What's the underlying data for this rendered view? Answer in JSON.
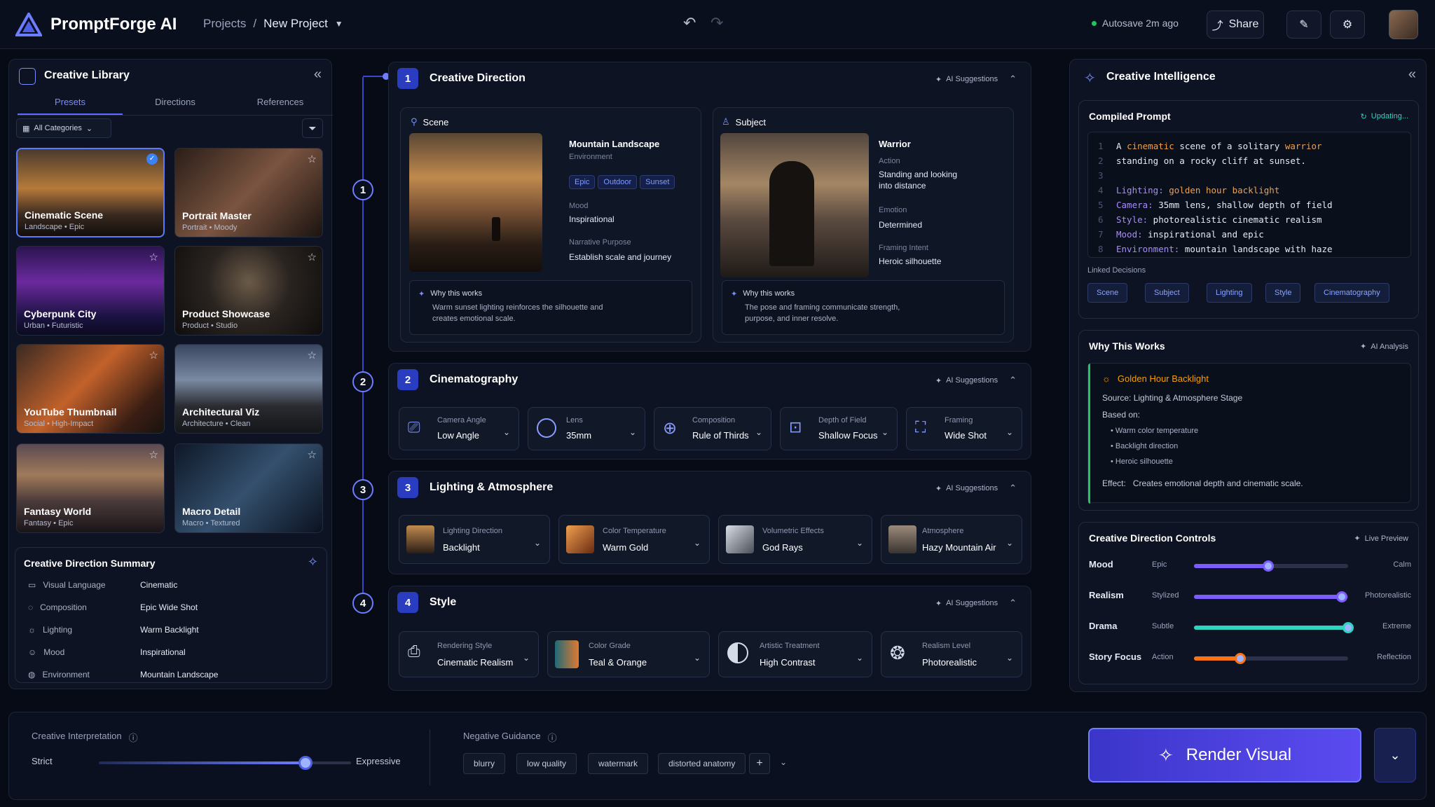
{
  "topbar": {
    "app_name": "PromptForge AI",
    "breadcrumb_root": "Projects",
    "breadcrumb_sep": "/",
    "breadcrumb_current": "New Project",
    "autosave": "Autosave 2m ago",
    "share_label": "Share"
  },
  "library": {
    "title": "Creative Library",
    "tabs": [
      "Presets",
      "Directions",
      "References"
    ],
    "filter": "All Categories",
    "presets": [
      {
        "title": "Cinematic Scene",
        "sub": "Landscape • Epic"
      },
      {
        "title": "Portrait Master",
        "sub": "Portrait • Moody"
      },
      {
        "title": "Cyberpunk City",
        "sub": "Urban • Futuristic"
      },
      {
        "title": "Product Showcase",
        "sub": "Product • Studio"
      },
      {
        "title": "YouTube Thumbnail",
        "sub": "Social • High-Impact"
      },
      {
        "title": "Architectural Viz",
        "sub": "Architecture • Clean"
      },
      {
        "title": "Fantasy World",
        "sub": "Fantasy • Epic"
      },
      {
        "title": "Macro Detail",
        "sub": "Macro • Textured"
      }
    ],
    "summary_title": "Creative Direction Summary",
    "summary": [
      {
        "label": "Visual Language",
        "value": "Cinematic"
      },
      {
        "label": "Composition",
        "value": "Epic Wide Shot"
      },
      {
        "label": "Lighting",
        "value": "Warm Backlight"
      },
      {
        "label": "Mood",
        "value": "Inspirational"
      },
      {
        "label": "Environment",
        "value": "Mountain Landscape"
      }
    ]
  },
  "steps": [
    "1",
    "2",
    "3",
    "4"
  ],
  "ai_suggestions": "AI Suggestions",
  "direction": {
    "num": "1",
    "title": "Creative Direction",
    "scene": {
      "header": "Scene",
      "name": "Mountain Landscape",
      "type": "Environment",
      "tags": [
        "Epic",
        "Outdoor",
        "Sunset"
      ],
      "mood_label": "Mood",
      "mood": "Inspirational",
      "purpose_label": "Narrative Purpose",
      "purpose": "Establish scale and journey",
      "why_title": "Why this works",
      "why_text_1": "Warm sunset lighting reinforces the silhouette and",
      "why_text_2": "creates emotional scale."
    },
    "subject": {
      "header": "Subject",
      "name": "Warrior",
      "action_label": "Action",
      "action_1": "Standing and looking",
      "action_2": "into distance",
      "emotion_label": "Emotion",
      "emotion": "Determined",
      "framing_label": "Framing Intent",
      "framing": "Heroic silhouette",
      "why_title": "Why this works",
      "why_text_1": "The pose and framing communicate strength,",
      "why_text_2": "purpose, and inner resolve."
    }
  },
  "cinematography": {
    "num": "2",
    "title": "Cinematography",
    "controls": [
      {
        "label": "Camera Angle",
        "value": "Low Angle"
      },
      {
        "label": "Lens",
        "value": "35mm"
      },
      {
        "label": "Composition",
        "value": "Rule of Thirds"
      },
      {
        "label": "Depth of Field",
        "value": "Shallow Focus"
      },
      {
        "label": "Framing",
        "value": "Wide Shot"
      }
    ]
  },
  "lighting": {
    "num": "3",
    "title": "Lighting & Atmosphere",
    "controls": [
      {
        "label": "Lighting Direction",
        "value": "Backlight"
      },
      {
        "label": "Color Temperature",
        "value": "Warm Gold"
      },
      {
        "label": "Volumetric Effects",
        "value": "God Rays"
      },
      {
        "label": "Atmosphere",
        "value": "Hazy Mountain Air"
      }
    ]
  },
  "style": {
    "num": "4",
    "title": "Style",
    "controls": [
      {
        "label": "Rendering Style",
        "value": "Cinematic Realism"
      },
      {
        "label": "Color Grade",
        "value": "Teal & Orange"
      },
      {
        "label": "Artistic Treatment",
        "value": "High Contrast"
      },
      {
        "label": "Realism Level",
        "value": "Photorealistic"
      }
    ]
  },
  "intelligence": {
    "title": "Creative Intelligence",
    "compiled_title": "Compiled Prompt",
    "updating": "Updating...",
    "line_numbers": [
      "1",
      "2",
      "3",
      "4",
      "5",
      "6",
      "7",
      "8"
    ],
    "code": {
      "l1_a": "A ",
      "l1_b": "cinematic",
      "l1_c": " scene of a solitary ",
      "l1_d": "warrior",
      "l2": "standing on a rocky cliff at sunset.",
      "l4_k": "Lighting:",
      "l4_v": " golden hour backlight",
      "l5_k": "Camera:",
      "l5_v": " 35mm lens, shallow depth of field",
      "l6_k": "Style:",
      "l6_v": " photorealistic cinematic realism",
      "l7_k": "Mood:",
      "l7_v": " inspirational and epic",
      "l8_k": "Environment:",
      "l8_v": " mountain landscape with haze"
    },
    "linked_title": "Linked Decisions",
    "linked": [
      "Scene",
      "Subject",
      "Lighting",
      "Style",
      "Cinematography"
    ],
    "why_title": "Why This Works",
    "ai_analysis": "AI Analysis",
    "why_heading": "Golden Hour Backlight",
    "source_label": "Source:",
    "source": "Lighting & Atmosphere Stage",
    "based_on": "Based on:",
    "bullets": [
      "Warm color temperature",
      "Backlight direction",
      "Heroic silhouette"
    ],
    "effect_label": "Effect:",
    "effect": "Creates emotional depth and cinematic scale.",
    "controls_title": "Creative Direction Controls",
    "live_preview": "Live Preview",
    "sliders": [
      {
        "name": "Mood",
        "left": "Epic",
        "right": "Calm",
        "value": 0.48,
        "color": "#7b5cff"
      },
      {
        "name": "Realism",
        "left": "Stylized",
        "right": "Photorealistic",
        "value": 0.96,
        "color": "#7b5cff"
      },
      {
        "name": "Drama",
        "left": "Subtle",
        "right": "Extreme",
        "value": 1.0,
        "color": "#2dd4bf"
      },
      {
        "name": "Story Focus",
        "left": "Action",
        "right": "Reflection",
        "value": 0.3,
        "color": "#f97316"
      }
    ]
  },
  "bottom": {
    "interp_label": "Creative Interpretation",
    "strict": "Strict",
    "expressive": "Expressive",
    "interp_value": 0.82,
    "neg_label": "Negative Guidance",
    "neg_tags": [
      "blurry",
      "low quality",
      "watermark",
      "distorted anatomy"
    ],
    "render_label": "Render Visual"
  }
}
